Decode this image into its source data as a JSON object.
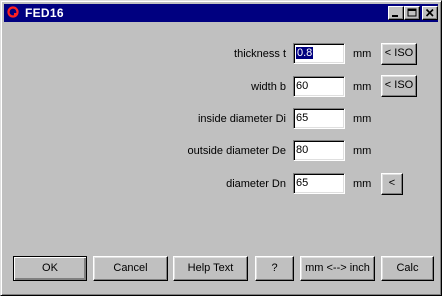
{
  "window": {
    "title": "FED16",
    "icon": "spring-app-icon",
    "controls": [
      "minimize-icon",
      "maximize-icon",
      "close-icon"
    ]
  },
  "fields": [
    {
      "label": "thickness t",
      "value": "0.8",
      "unit": "mm",
      "action": "< ISO",
      "selected": true
    },
    {
      "label": "width b",
      "value": "60",
      "unit": "mm",
      "action": "< ISO"
    },
    {
      "label": "inside diameter Di",
      "value": "65",
      "unit": "mm"
    },
    {
      "label": "outside diameter De",
      "value": "80",
      "unit": "mm"
    },
    {
      "label": "diameter Dn",
      "value": "65",
      "unit": "mm",
      "action": "<"
    }
  ],
  "buttons": {
    "ok": "OK",
    "cancel": "Cancel",
    "help_text": "Help Text",
    "question": "?",
    "mm_inch": "mm <--> inch",
    "calc": "Calc"
  },
  "colors": {
    "titlebar": "#000080",
    "face": "#c0c0c0",
    "selection": "#000080"
  }
}
